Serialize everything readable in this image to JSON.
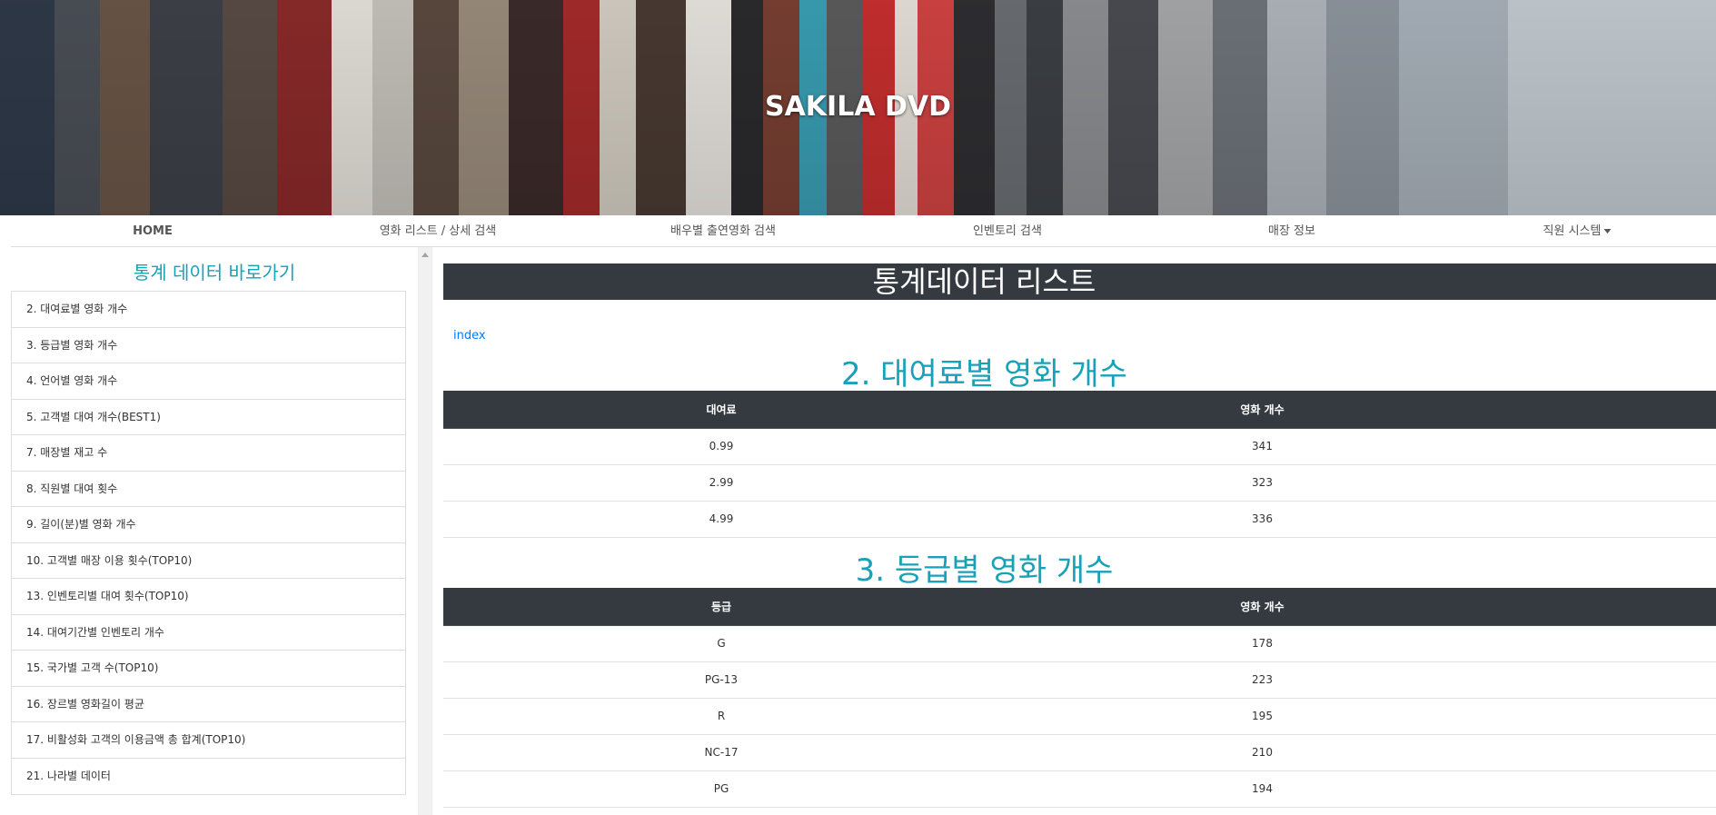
{
  "banner": {
    "title": "SAKILA DVD"
  },
  "nav": {
    "items": [
      {
        "label": "HOME"
      },
      {
        "label": "영화 리스트 / 상세 검색"
      },
      {
        "label": "배우별 출연영화 검색"
      },
      {
        "label": "인벤토리 검색"
      },
      {
        "label": "매장 정보"
      },
      {
        "label": "직원 시스템"
      }
    ]
  },
  "sidebar": {
    "title": "통계 데이터 바로가기",
    "items": [
      {
        "label": "2. 대여료별 영화 개수"
      },
      {
        "label": "3. 등급별 영화 개수"
      },
      {
        "label": "4. 언어별 영화 개수"
      },
      {
        "label": "5. 고객별 대여 개수(BEST1)"
      },
      {
        "label": "7. 매장별 재고 수"
      },
      {
        "label": "8. 직원별 대여 횟수"
      },
      {
        "label": "9. 길이(분)별 영화 개수"
      },
      {
        "label": "10. 고객별 매장 이용 횟수(TOP10)"
      },
      {
        "label": "13. 인벤토리별 대여 횟수(TOP10)"
      },
      {
        "label": "14. 대여기간별 인벤토리 개수"
      },
      {
        "label": "15. 국가별 고객 수(TOP10)"
      },
      {
        "label": "16. 장르별 영화길이 평균"
      },
      {
        "label": "17. 비활성화 고객의 이용금액 총 합계(TOP10)"
      },
      {
        "label": "21. 나라별 데이터"
      }
    ]
  },
  "main": {
    "title": "통계데이터 리스트",
    "index_link": "index",
    "sections": [
      {
        "title": "2. 대여료별 영화 개수",
        "headers": [
          "대여료",
          "영화 개수"
        ],
        "rows": [
          [
            "0.99",
            "341"
          ],
          [
            "2.99",
            "323"
          ],
          [
            "4.99",
            "336"
          ]
        ]
      },
      {
        "title": "3. 등급별 영화 개수",
        "headers": [
          "등급",
          "영화 개수"
        ],
        "rows": [
          [
            "G",
            "178"
          ],
          [
            "PG-13",
            "223"
          ],
          [
            "R",
            "195"
          ],
          [
            "NC-17",
            "210"
          ],
          [
            "PG",
            "194"
          ]
        ]
      }
    ]
  }
}
